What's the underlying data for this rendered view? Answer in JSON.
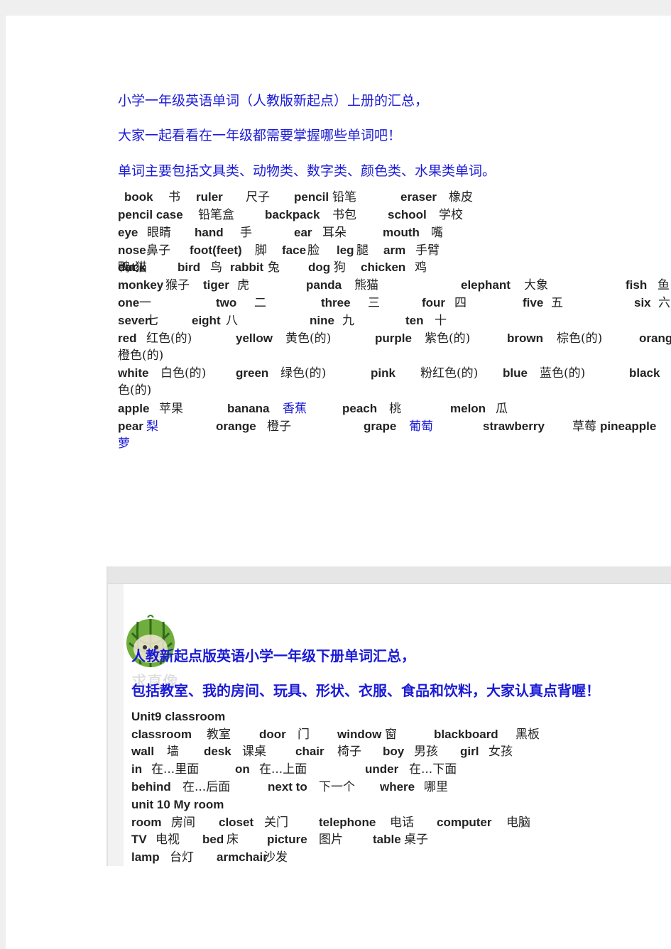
{
  "upper": {
    "intro_lines": [
      "小学一年级英语单词（人教版新起点）上册的汇总，",
      "大家一起看看在一年级都需要掌握哪些单词吧！",
      "单词主要包括文具类、动物类、数字类、颜色类、水果类单词。"
    ],
    "rows": [
      [
        [
          "book",
          "书"
        ],
        [
          "ruler",
          "尺子"
        ],
        [
          "pencil",
          "铅笔"
        ],
        [
          "eraser",
          "橡皮"
        ]
      ],
      [
        [
          "pencil case",
          "铅笔盒"
        ],
        [
          "backpack",
          "书包"
        ],
        [
          "school",
          "学校"
        ]
      ],
      [
        [
          "eye",
          "眼睛"
        ],
        [
          "hand",
          "手"
        ],
        [
          "ear",
          "耳朵"
        ],
        [
          "mouth",
          "嘴"
        ]
      ],
      [
        [
          "nose",
          "鼻子"
        ],
        [
          "foot(feet)",
          "脚"
        ],
        [
          "face",
          "脸"
        ],
        [
          "leg",
          "腿"
        ],
        [
          "arm",
          "手臂"
        ]
      ],
      [
        [
          "cat",
          "猫"
        ],
        [
          "bird",
          "鸟"
        ],
        [
          "rabbit",
          "兔"
        ],
        [
          "dog",
          "狗"
        ],
        [
          "chicken",
          "鸡"
        ],
        [
          "duck",
          "鸭"
        ]
      ],
      [
        [
          "monkey",
          "猴子"
        ],
        [
          "tiger",
          "虎"
        ],
        [
          "panda",
          "熊猫"
        ],
        [
          "elephant",
          "大象"
        ],
        [
          "fish",
          "鱼"
        ]
      ],
      [
        [
          "one",
          "一"
        ],
        [
          "two",
          "二"
        ],
        [
          "three",
          "三"
        ],
        [
          "four",
          "四"
        ],
        [
          "five",
          "五"
        ],
        [
          "six",
          "六"
        ]
      ],
      [
        [
          "seven",
          "七"
        ],
        [
          "eight",
          "八"
        ],
        [
          "nine",
          "九"
        ],
        [
          "ten",
          "十"
        ]
      ],
      [
        [
          "red",
          "红色(的)"
        ],
        [
          "yellow",
          "黄色(的)"
        ],
        [
          "purple",
          "紫色(的)"
        ],
        [
          "brown",
          "棕色(的)"
        ],
        [
          "orange",
          ""
        ]
      ],
      [
        [
          "",
          "橙色(的)"
        ]
      ],
      [
        [
          "white",
          "白色(的)"
        ],
        [
          "green",
          "绿色(的)"
        ],
        [
          "pink",
          "粉红色(的)"
        ],
        [
          "blue",
          "蓝色(的)"
        ],
        [
          "black",
          ""
        ]
      ],
      [
        [
          "",
          "色(的)"
        ]
      ],
      [
        [
          "apple",
          "苹果"
        ],
        [
          "banana",
          "香蕉"
        ],
        [
          "peach",
          "桃"
        ],
        [
          "melon",
          "瓜"
        ]
      ],
      [
        [
          "pear",
          "梨"
        ],
        [
          "orange",
          "橙子"
        ],
        [
          "grape",
          "葡萄"
        ],
        [
          "strawberry",
          "草莓"
        ],
        [
          "pineapple",
          ""
        ]
      ],
      [
        [
          "",
          "萝"
        ]
      ]
    ]
  },
  "lower": {
    "heading_lines": [
      "人教新起点版英语小学一年级下册单词汇总，",
      "包括教室、我的房间、玩具、形状、衣服、食品和饮料，大家认真点背喔！"
    ],
    "watermark": "求真像",
    "rows": [
      [
        [
          "Unit9 classroom",
          ""
        ]
      ],
      [
        [
          "classroom",
          "教室"
        ],
        [
          "door",
          "门"
        ],
        [
          "window",
          "窗"
        ],
        [
          "blackboard",
          "黑板"
        ]
      ],
      [
        [
          "wall",
          "墙"
        ],
        [
          "desk",
          "课桌"
        ],
        [
          "chair",
          "椅子"
        ],
        [
          "boy",
          "男孩"
        ],
        [
          "girl",
          "女孩"
        ]
      ],
      [
        [
          "in",
          "在...里面"
        ],
        [
          "on",
          "在...上面"
        ],
        [
          "under",
          "在...下面"
        ]
      ],
      [
        [
          "behind",
          "在...后面"
        ],
        [
          "next to",
          "下一个"
        ],
        [
          "where",
          "哪里"
        ]
      ],
      [
        [
          "unit 10 My room",
          ""
        ]
      ],
      [
        [
          "room",
          "房间"
        ],
        [
          "closet",
          "关门"
        ],
        [
          "telephone",
          "电话"
        ],
        [
          "computer",
          "电脑"
        ]
      ],
      [
        [
          "TV",
          "电视"
        ],
        [
          "bed",
          "床"
        ],
        [
          "picture",
          "图片"
        ],
        [
          "table",
          "桌子"
        ]
      ],
      [
        [
          "lamp",
          "台灯"
        ],
        [
          "armchair",
          "沙发"
        ]
      ]
    ]
  }
}
